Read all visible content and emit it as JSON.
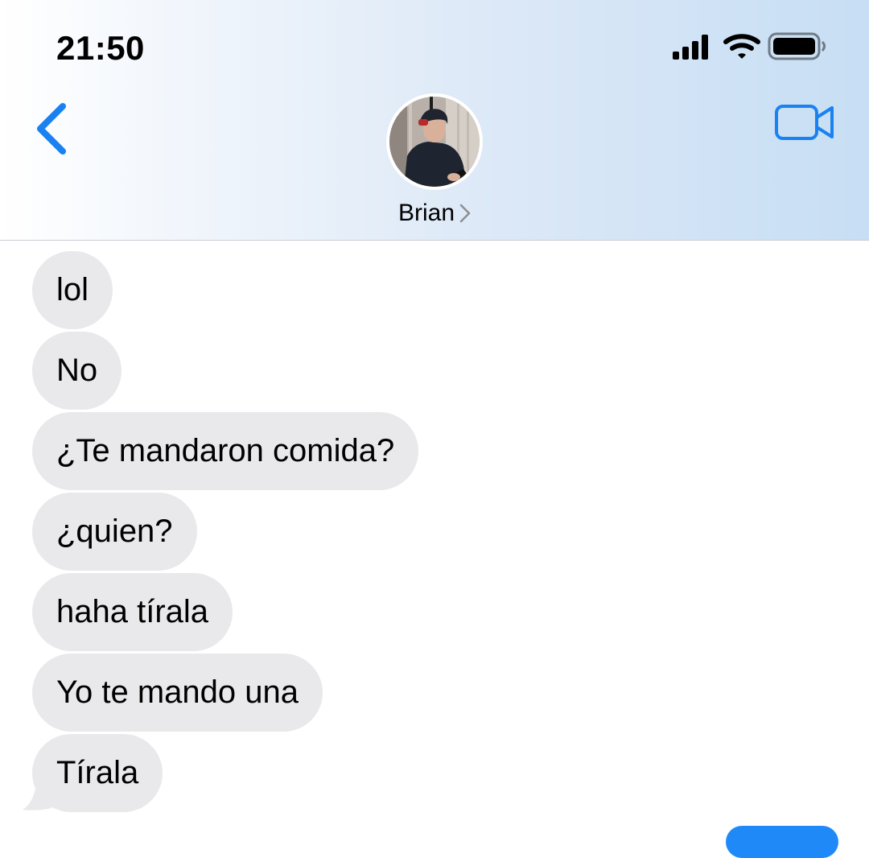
{
  "status_bar": {
    "time": "21:50"
  },
  "header": {
    "contact_name": "Brian",
    "back_icon": "chevron-left-icon",
    "video_icon": "video-camera-icon",
    "accent_color": "#1a82f0"
  },
  "messages": [
    {
      "text": "lol",
      "direction": "received"
    },
    {
      "text": "No",
      "direction": "received"
    },
    {
      "text": "¿Te mandaron comida?",
      "direction": "received"
    },
    {
      "text": "¿quien?",
      "direction": "received"
    },
    {
      "text": "haha tírala",
      "direction": "received"
    },
    {
      "text": "Yo te mando una",
      "direction": "received"
    },
    {
      "text": "Tírala",
      "direction": "received"
    }
  ],
  "colors": {
    "received_bubble": "#e9e9eb",
    "sent_bubble": "#1f8af7"
  }
}
